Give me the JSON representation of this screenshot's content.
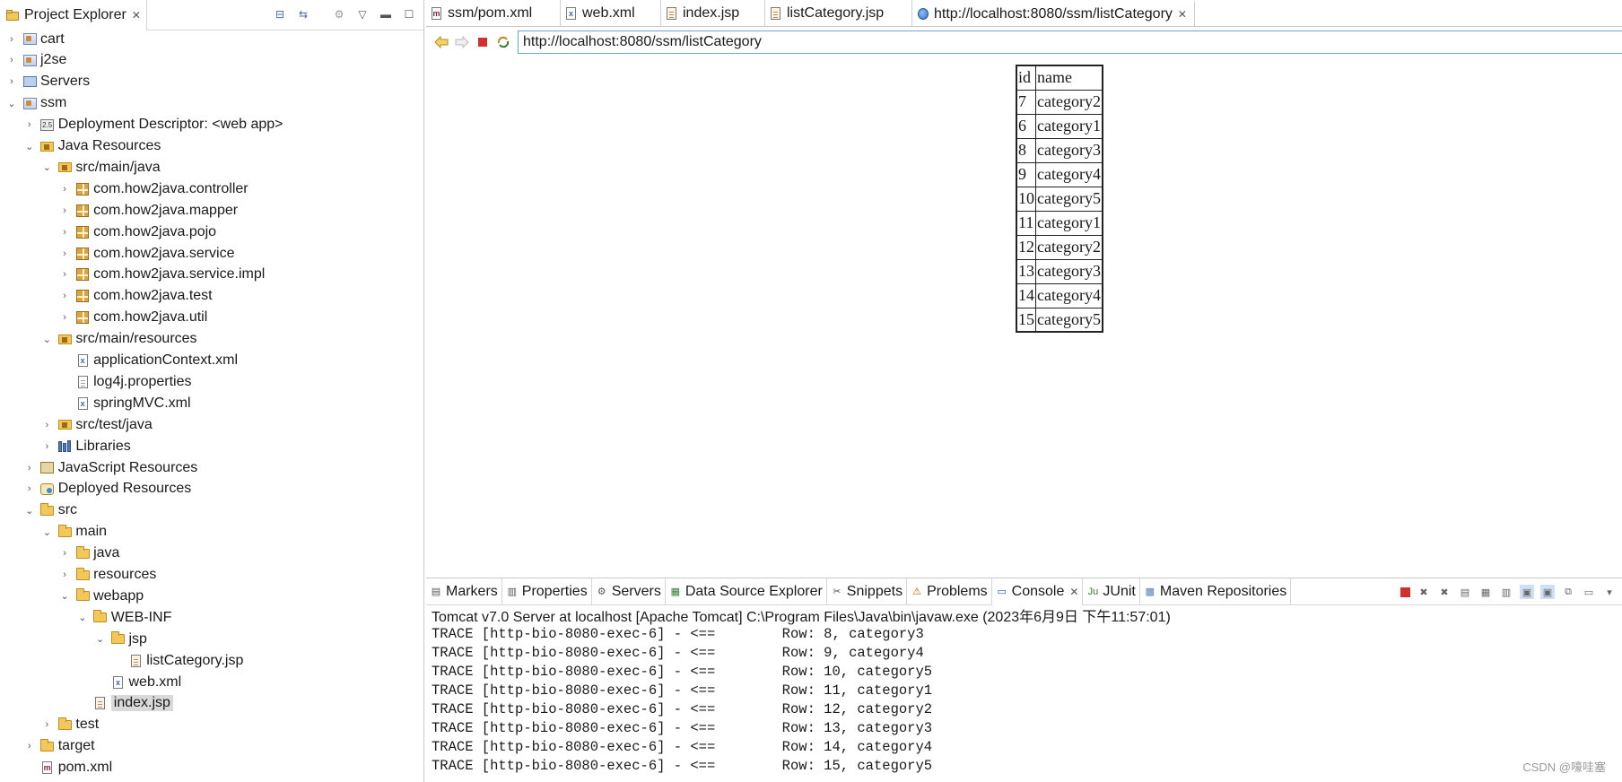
{
  "project_explorer": {
    "title": "Project Explorer",
    "tree": [
      {
        "label": "cart",
        "depth": 0,
        "expanded": false,
        "icon": "project-icon"
      },
      {
        "label": "j2se",
        "depth": 0,
        "expanded": false,
        "icon": "project-icon"
      },
      {
        "label": "Servers",
        "depth": 0,
        "expanded": false,
        "icon": "servers-icon"
      },
      {
        "label": "ssm",
        "depth": 0,
        "expanded": true,
        "icon": "project-icon"
      },
      {
        "label": "Deployment Descriptor: <web app>",
        "depth": 1,
        "expanded": false,
        "icon": "deployment-descriptor-icon"
      },
      {
        "label": "Java Resources",
        "depth": 1,
        "expanded": true,
        "icon": "java-resources-icon"
      },
      {
        "label": "src/main/java",
        "depth": 2,
        "expanded": true,
        "icon": "source-folder-icon"
      },
      {
        "label": "com.how2java.controller",
        "depth": 3,
        "expanded": false,
        "icon": "package-icon"
      },
      {
        "label": "com.how2java.mapper",
        "depth": 3,
        "expanded": false,
        "icon": "package-icon"
      },
      {
        "label": "com.how2java.pojo",
        "depth": 3,
        "expanded": false,
        "icon": "package-icon"
      },
      {
        "label": "com.how2java.service",
        "depth": 3,
        "expanded": false,
        "icon": "package-icon"
      },
      {
        "label": "com.how2java.service.impl",
        "depth": 3,
        "expanded": false,
        "icon": "package-icon"
      },
      {
        "label": "com.how2java.test",
        "depth": 3,
        "expanded": false,
        "icon": "package-icon"
      },
      {
        "label": "com.how2java.util",
        "depth": 3,
        "expanded": false,
        "icon": "package-icon"
      },
      {
        "label": "src/main/resources",
        "depth": 2,
        "expanded": true,
        "icon": "source-folder-icon"
      },
      {
        "label": "applicationContext.xml",
        "depth": 3,
        "leaf": true,
        "icon": "xml-file-icon"
      },
      {
        "label": "log4j.properties",
        "depth": 3,
        "leaf": true,
        "icon": "file-icon"
      },
      {
        "label": "springMVC.xml",
        "depth": 3,
        "leaf": true,
        "icon": "xml-file-icon"
      },
      {
        "label": "src/test/java",
        "depth": 2,
        "expanded": false,
        "icon": "source-folder-icon"
      },
      {
        "label": "Libraries",
        "depth": 2,
        "expanded": false,
        "icon": "libraries-icon"
      },
      {
        "label": "JavaScript Resources",
        "depth": 1,
        "expanded": false,
        "icon": "javascript-resources-icon"
      },
      {
        "label": "Deployed Resources",
        "depth": 1,
        "expanded": false,
        "icon": "deployed-resources-icon"
      },
      {
        "label": "src",
        "depth": 1,
        "expanded": true,
        "icon": "folder-icon"
      },
      {
        "label": "main",
        "depth": 2,
        "expanded": true,
        "icon": "folder-icon"
      },
      {
        "label": "java",
        "depth": 3,
        "expanded": false,
        "icon": "folder-icon"
      },
      {
        "label": "resources",
        "depth": 3,
        "expanded": false,
        "icon": "folder-icon"
      },
      {
        "label": "webapp",
        "depth": 3,
        "expanded": true,
        "icon": "folder-icon"
      },
      {
        "label": "WEB-INF",
        "depth": 4,
        "expanded": true,
        "icon": "folder-icon"
      },
      {
        "label": "jsp",
        "depth": 5,
        "expanded": true,
        "icon": "folder-icon"
      },
      {
        "label": "listCategory.jsp",
        "depth": 6,
        "leaf": true,
        "icon": "jsp-file-icon"
      },
      {
        "label": "web.xml",
        "depth": 5,
        "leaf": true,
        "icon": "xml-file-icon"
      },
      {
        "label": "index.jsp",
        "depth": 4,
        "leaf": true,
        "icon": "jsp-file-icon",
        "selected": true
      },
      {
        "label": "test",
        "depth": 2,
        "expanded": false,
        "icon": "folder-icon"
      },
      {
        "label": "target",
        "depth": 1,
        "expanded": false,
        "icon": "folder-icon"
      },
      {
        "label": "pom.xml",
        "depth": 1,
        "leaf": true,
        "icon": "maven-file-icon"
      }
    ]
  },
  "editor_tabs": [
    {
      "label": "ssm/pom.xml",
      "icon": "maven-file-icon"
    },
    {
      "label": "web.xml",
      "icon": "xml-file-icon"
    },
    {
      "label": "index.jsp",
      "icon": "jsp-file-icon"
    },
    {
      "label": "listCategory.jsp",
      "icon": "jsp-file-icon"
    },
    {
      "label": "http://localhost:8080/ssm/listCategory",
      "icon": "globe-icon",
      "active": true
    }
  ],
  "browser": {
    "url": "http://localhost:8080/ssm/listCategory",
    "table": {
      "headers": [
        "id",
        "name"
      ],
      "rows": [
        [
          "7",
          "category2"
        ],
        [
          "6",
          "category1"
        ],
        [
          "8",
          "category3"
        ],
        [
          "9",
          "category4"
        ],
        [
          "10",
          "category5"
        ],
        [
          "11",
          "category1"
        ],
        [
          "12",
          "category2"
        ],
        [
          "13",
          "category3"
        ],
        [
          "14",
          "category4"
        ],
        [
          "15",
          "category5"
        ]
      ]
    }
  },
  "bottom_tabs": [
    {
      "label": "Markers",
      "icon": "markers-icon"
    },
    {
      "label": "Properties",
      "icon": "properties-icon"
    },
    {
      "label": "Servers",
      "icon": "servers-icon"
    },
    {
      "label": "Data Source Explorer",
      "icon": "data-source-icon"
    },
    {
      "label": "Snippets",
      "icon": "snippets-icon"
    },
    {
      "label": "Problems",
      "icon": "problems-icon"
    },
    {
      "label": "Console",
      "icon": "console-icon",
      "active": true
    },
    {
      "label": "JUnit",
      "icon": "junit-icon"
    },
    {
      "label": "Maven Repositories",
      "icon": "maven-repo-icon"
    }
  ],
  "console": {
    "title": "Tomcat v7.0 Server at localhost [Apache Tomcat] C:\\Program Files\\Java\\bin\\javaw.exe (2023年6月9日 下午11:57:01)",
    "lines": [
      "TRACE [http-bio-8080-exec-6] - <==        Row: 8, category3",
      "TRACE [http-bio-8080-exec-6] - <==        Row: 9, category4",
      "TRACE [http-bio-8080-exec-6] - <==        Row: 10, category5",
      "TRACE [http-bio-8080-exec-6] - <==        Row: 11, category1",
      "TRACE [http-bio-8080-exec-6] - <==        Row: 12, category2",
      "TRACE [http-bio-8080-exec-6] - <==        Row: 13, category3",
      "TRACE [http-bio-8080-exec-6] - <==        Row: 14, category4",
      "TRACE [http-bio-8080-exec-6] - <==        Row: 15, category5"
    ]
  },
  "watermark": "CSDN @嚎哇塞",
  "colors": {
    "stop_red": "#d32f2f",
    "url_border": "#6aa5d8",
    "selection": "#d9d9d9"
  }
}
